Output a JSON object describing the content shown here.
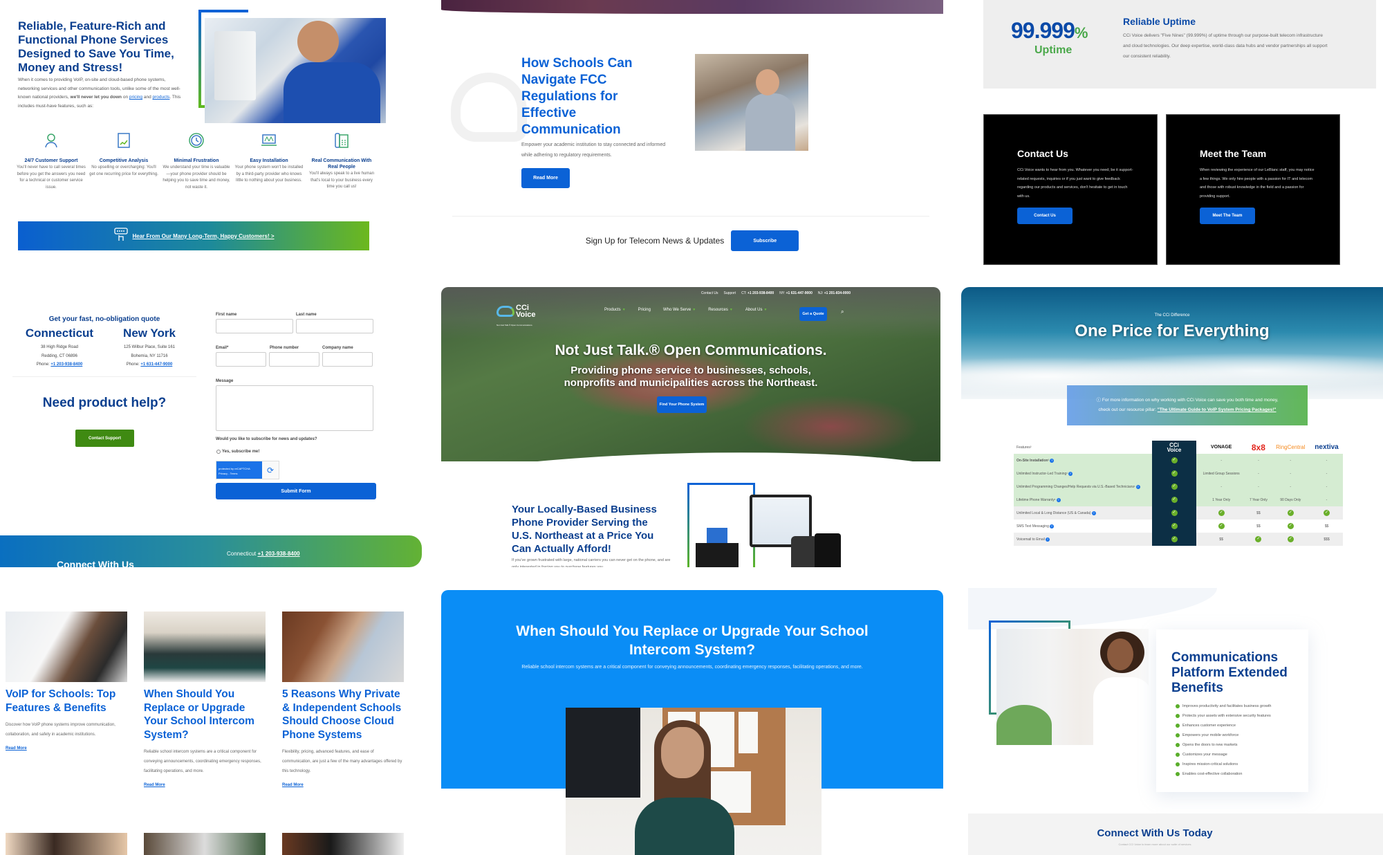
{
  "panel1": {
    "heading": "Reliable, Feature-Rich and Functional Phone Services Designed to Save You Time, Money and Stress!",
    "intro_before": "When it comes to providing VoIP, on-site and cloud-based phone systems, networking services and other communication tools, unlike some of the most well-known national providers, ",
    "intro_bold": "we'll never let you down",
    "intro_on": " on ",
    "link_pricing": "pricing",
    "intro_and": " and ",
    "link_products": "products",
    "intro_after": ". This includes must-have features, such as:",
    "features": [
      {
        "icon": "support-agent-icon",
        "title": "24/7 Customer Support",
        "desc": "You'll never have to call several times before you get the answers you need for a technical or customer service issue."
      },
      {
        "icon": "analysis-chart-icon",
        "title": "Competitive Analysis",
        "desc": "No upselling or overcharging: You'll get one recurring price for everything."
      },
      {
        "icon": "clock-icon",
        "title": "Minimal Frustration",
        "desc": "We understand your time is valuable—your phone provider should be helping you to save time and money, not waste it."
      },
      {
        "icon": "installation-laptop-icon",
        "title": "Easy Installation",
        "desc": "Your phone system won't be installed by a third-party provider who knows little to nothing about your business."
      },
      {
        "icon": "desk-phone-icon",
        "title": "Real Communication With Real People",
        "desc": "You'll always speak to a live human that's local to your business every time you call us!"
      }
    ],
    "banner_link": "Hear From Our Many Long-Term, Happy Customers! >"
  },
  "panel2": {
    "heading": "How Schools Can Navigate FCC Regulations for Effective Communication",
    "subtext": "Empower your academic institution to stay connected and informed while adhering to regulatory requirements.",
    "read_more": "Read More",
    "signup_label": "Sign Up for Telecom News & Updates",
    "subscribe": "Subscribe"
  },
  "panel3": {
    "big_number": "99.999",
    "big_pct": "%",
    "uptime_label": "Uptime",
    "title": "Reliable Uptime",
    "desc": "CCi Voice delivers \"Five Nines\" (99.999%) of uptime through our purpose-built telecom infrastructure and cloud technologies. Our deep expertise, world-class data hubs and vendor partnerships all support our consistent reliability.",
    "cards": [
      {
        "title": "Contact Us",
        "desc": "CCi Voice wants to hear from you. Whatever you need, be it support-related requests, inquiries or if you just want to give feedback regarding our products and services, don't hesitate to get in touch with us.",
        "button": "Contact Us"
      },
      {
        "title": "Meet the Team",
        "desc": "When reviewing the experience of our LeBlanc staff, you may notice a few things. We only hire people with a passion for IT and telecom and those with robust knowledge in the field and a passion for providing support.",
        "button": "Meet The Team"
      }
    ]
  },
  "panel4": {
    "quote_heading": "Get your fast, no-obligation quote",
    "locations": [
      {
        "name": "Connecticut",
        "line1": "38 High Ridge Road",
        "line2": "Redding, CT 06896",
        "phone_label": "Phone: ",
        "phone": "+1 203-938-8400"
      },
      {
        "name": "New York",
        "line1": "125 Wilbur Place, Suite 161",
        "line2": "Bohemia, NY 11716",
        "phone_label": "Phone: ",
        "phone": "+1 631-447-9000"
      }
    ],
    "need_help": "Need product help?",
    "contact_support": "Contact Support",
    "form": {
      "first_name": "First name",
      "last_name": "Last name",
      "email": "Email*",
      "phone": "Phone number",
      "company": "Company name",
      "message": "Message",
      "subscribe_question": "Would you like to subscribe for news and updates?",
      "subscribe_option": "Yes, subscribe me!",
      "captcha_text": "protected by reCAPTCHA",
      "captcha_links": "Privacy - Terms",
      "submit": "Submit Form"
    },
    "footer_heading": "Connect With Us",
    "footer_ct_label": "Connecticut ",
    "footer_ct_phone": "+1 203-938-8400"
  },
  "panel5": {
    "utility": {
      "contact": "Contact Us",
      "support": "Support",
      "ct_label": "CT:",
      "ct": "+1 203-938-8400",
      "ny_label": "NY:",
      "ny": "+1 631-447-9000",
      "nj_label": "NJ:",
      "nj": "+1 201-834-0000"
    },
    "logo_top": "CCi",
    "logo_bottom": "Voice",
    "logo_tagline": "Not Just Talk.® Open Communications.",
    "nav": [
      "Products",
      "Pricing",
      "Who We Serve",
      "Resources",
      "About Us"
    ],
    "nav_has_chevron": [
      true,
      false,
      true,
      true,
      true
    ],
    "get_quote": "Get a Quote",
    "hero_title": "Not Just Talk.® Open Communications.",
    "hero_sub": "Providing phone service to businesses, schools, nonprofits and municipalities across the Northeast.",
    "hero_cta": "Find Your Phone System",
    "section_title": "Your Locally-Based Business Phone Provider Serving the U.S. Northeast at a Price You Can Actually Afford!",
    "section_text": "If you've grown frustrated with large, national carriers you can never get on the phone, and are only interested in forcing you to purchase features you"
  },
  "panel6": {
    "eyebrow": "The CCi Difference",
    "title": "One Price for Everything",
    "info_line1": "For more information on why working with CCi Voice can save you both time and money,",
    "info_line2": "check out our resource pillar: ",
    "info_link": "\"The Ultimate Guide to VoIP System Pricing Packages!\"",
    "table": {
      "feature_header": "Features²",
      "brands": [
        "CCi Voice",
        "VONAGE",
        "8x8",
        "RingCentral",
        "nextiva"
      ],
      "rows": [
        {
          "feature": "On-Site Installation¹",
          "bold": true,
          "values": [
            "check",
            "-",
            "-",
            "-",
            "-"
          ],
          "band": "green"
        },
        {
          "feature": "Unlimited Instructor-Led Training¹",
          "bold": false,
          "values": [
            "check",
            "Limited Group Sessions",
            "-",
            "-",
            "-"
          ],
          "band": "green"
        },
        {
          "feature": "Unlimited Programming Changes/Help Requests via U.S.-Based Technicians¹",
          "bold": false,
          "values": [
            "check",
            "-",
            "-",
            "-",
            "-"
          ],
          "band": "green"
        },
        {
          "feature": "Lifetime Phone Warranty¹",
          "bold": false,
          "values": [
            "check",
            "1 Year Only",
            "7 Year Only",
            "90 Days Only",
            "-"
          ],
          "band": "green"
        },
        {
          "feature": "Unlimited Local & Long Distance (US & Canada)",
          "bold": false,
          "values": [
            "check",
            "check",
            "$$",
            "check",
            "check"
          ],
          "band": "gray"
        },
        {
          "feature": "SMS Text Messaging",
          "bold": false,
          "values": [
            "check",
            "check",
            "$$",
            "check",
            "$$"
          ],
          "band": "white"
        },
        {
          "feature": "Voicemail to Email",
          "bold": false,
          "values": [
            "check",
            "$$",
            "check",
            "check",
            "$$$"
          ],
          "band": "gray"
        }
      ]
    }
  },
  "panel7": {
    "posts": [
      {
        "title": "VoIP for Schools: Top Features & Benefits",
        "desc": "Discover how VoIP phone systems improve communication, collaboration, and safety in academic institutions.",
        "link": "Read More"
      },
      {
        "title": "When Should You Replace or Upgrade Your School Intercom System?",
        "desc": "Reliable school intercom systems are a critical component for conveying announcements, coordinating emergency responses, facilitating operations, and more.",
        "link": "Read More"
      },
      {
        "title": "5 Reasons Why Private & Independent Schools Should Choose Cloud Phone Systems",
        "desc": "Flexibility, pricing, advanced features, and ease of communication, are just a few of the many advantages offered by this technology.",
        "link": "Read More"
      }
    ]
  },
  "panel8": {
    "title": "When Should You Replace or Upgrade Your School Intercom System?",
    "desc": "Reliable school intercom systems are a critical component for conveying announcements, coordinating emergency responses, facilitating operations, and more."
  },
  "panel9": {
    "title": "Communications Platform Extended Benefits",
    "benefits": [
      "Improves productivity and facilitates business growth",
      "Protects your assets with extensive security features",
      "Enhances customer experience",
      "Empowers your mobile workforce",
      "Opens the doors to new markets",
      "Customizes your message",
      "Inspires mission-critical solutions",
      "Enables cost-effective collaboration"
    ],
    "footer_title": "Connect With Us Today",
    "footer_desc": "Contact CCi Voice to learn more about our suite of services"
  },
  "colors": {
    "navy": "#0b3f8f",
    "brand_blue": "#0b62d6",
    "brand_green": "#5fb820",
    "support_green": "#3f8a12",
    "article_blue": "#0a8df6",
    "cci_dark": "#0c2f45"
  }
}
